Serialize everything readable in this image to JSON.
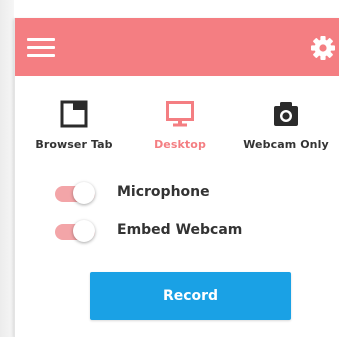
{
  "colors": {
    "header": "#f47e82",
    "accent": "#f47e82",
    "toggle_track": "#f3a5a8",
    "record_button": "#1aa1e5",
    "text": "#333333"
  },
  "header": {
    "menu_icon": "hamburger-icon",
    "settings_icon": "gear-icon"
  },
  "modes": [
    {
      "label": "Browser Tab",
      "icon": "browser-tab-icon",
      "selected": false
    },
    {
      "label": "Desktop",
      "icon": "monitor-icon",
      "selected": true
    },
    {
      "label": "Webcam Only",
      "icon": "camera-icon",
      "selected": false
    }
  ],
  "toggles": [
    {
      "label": "Microphone",
      "on": true
    },
    {
      "label": "Embed Webcam",
      "on": true
    }
  ],
  "record": {
    "label": "Record"
  }
}
